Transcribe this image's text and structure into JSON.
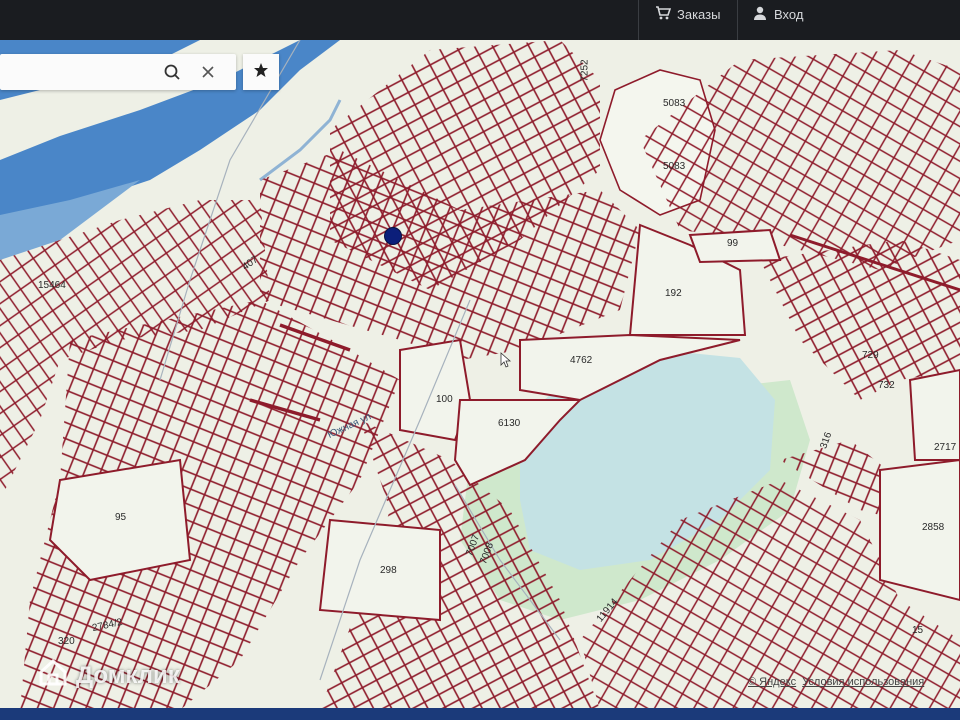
{
  "header": {
    "orders_label": "Заказы",
    "login_label": "Вход"
  },
  "search": {
    "placeholder": "",
    "value": ""
  },
  "plots": [
    {
      "id": "p7252",
      "label": "7252"
    },
    {
      "id": "p5083a",
      "label": "5083"
    },
    {
      "id": "p5083b",
      "label": "5083"
    },
    {
      "id": "p99",
      "label": "99"
    },
    {
      "id": "p192",
      "label": "192"
    },
    {
      "id": "p15464",
      "label": "15464"
    },
    {
      "id": "p407",
      "label": "407"
    },
    {
      "id": "p4762",
      "label": "4762"
    },
    {
      "id": "p100",
      "label": "100"
    },
    {
      "id": "p6130",
      "label": "6130"
    },
    {
      "id": "p729",
      "label": "729"
    },
    {
      "id": "p732",
      "label": "732"
    },
    {
      "id": "p316",
      "label": "316"
    },
    {
      "id": "p2717",
      "label": "2717"
    },
    {
      "id": "p95",
      "label": "95"
    },
    {
      "id": "p298",
      "label": "298"
    },
    {
      "id": "p7007",
      "label": "7007"
    },
    {
      "id": "p7008",
      "label": "7008"
    },
    {
      "id": "p2858",
      "label": "2858"
    },
    {
      "id": "p11914",
      "label": "11914"
    },
    {
      "id": "p27842",
      "label": "2784/2"
    },
    {
      "id": "p320",
      "label": "320"
    },
    {
      "id": "p15",
      "label": "15"
    }
  ],
  "streets": {
    "yuzhnaya": "Южная ул."
  },
  "footer": {
    "yandex": "© Яндекс",
    "terms": "Условия использования"
  },
  "watermark": {
    "brand": "Домклик"
  },
  "colors": {
    "water": "#4a86c8",
    "lake": "#c4e2e4",
    "forest": "#cfe8cc",
    "parcel_lines": "#8e1b2b",
    "land": "#eef0e6",
    "marker": "#0b1e7a"
  }
}
